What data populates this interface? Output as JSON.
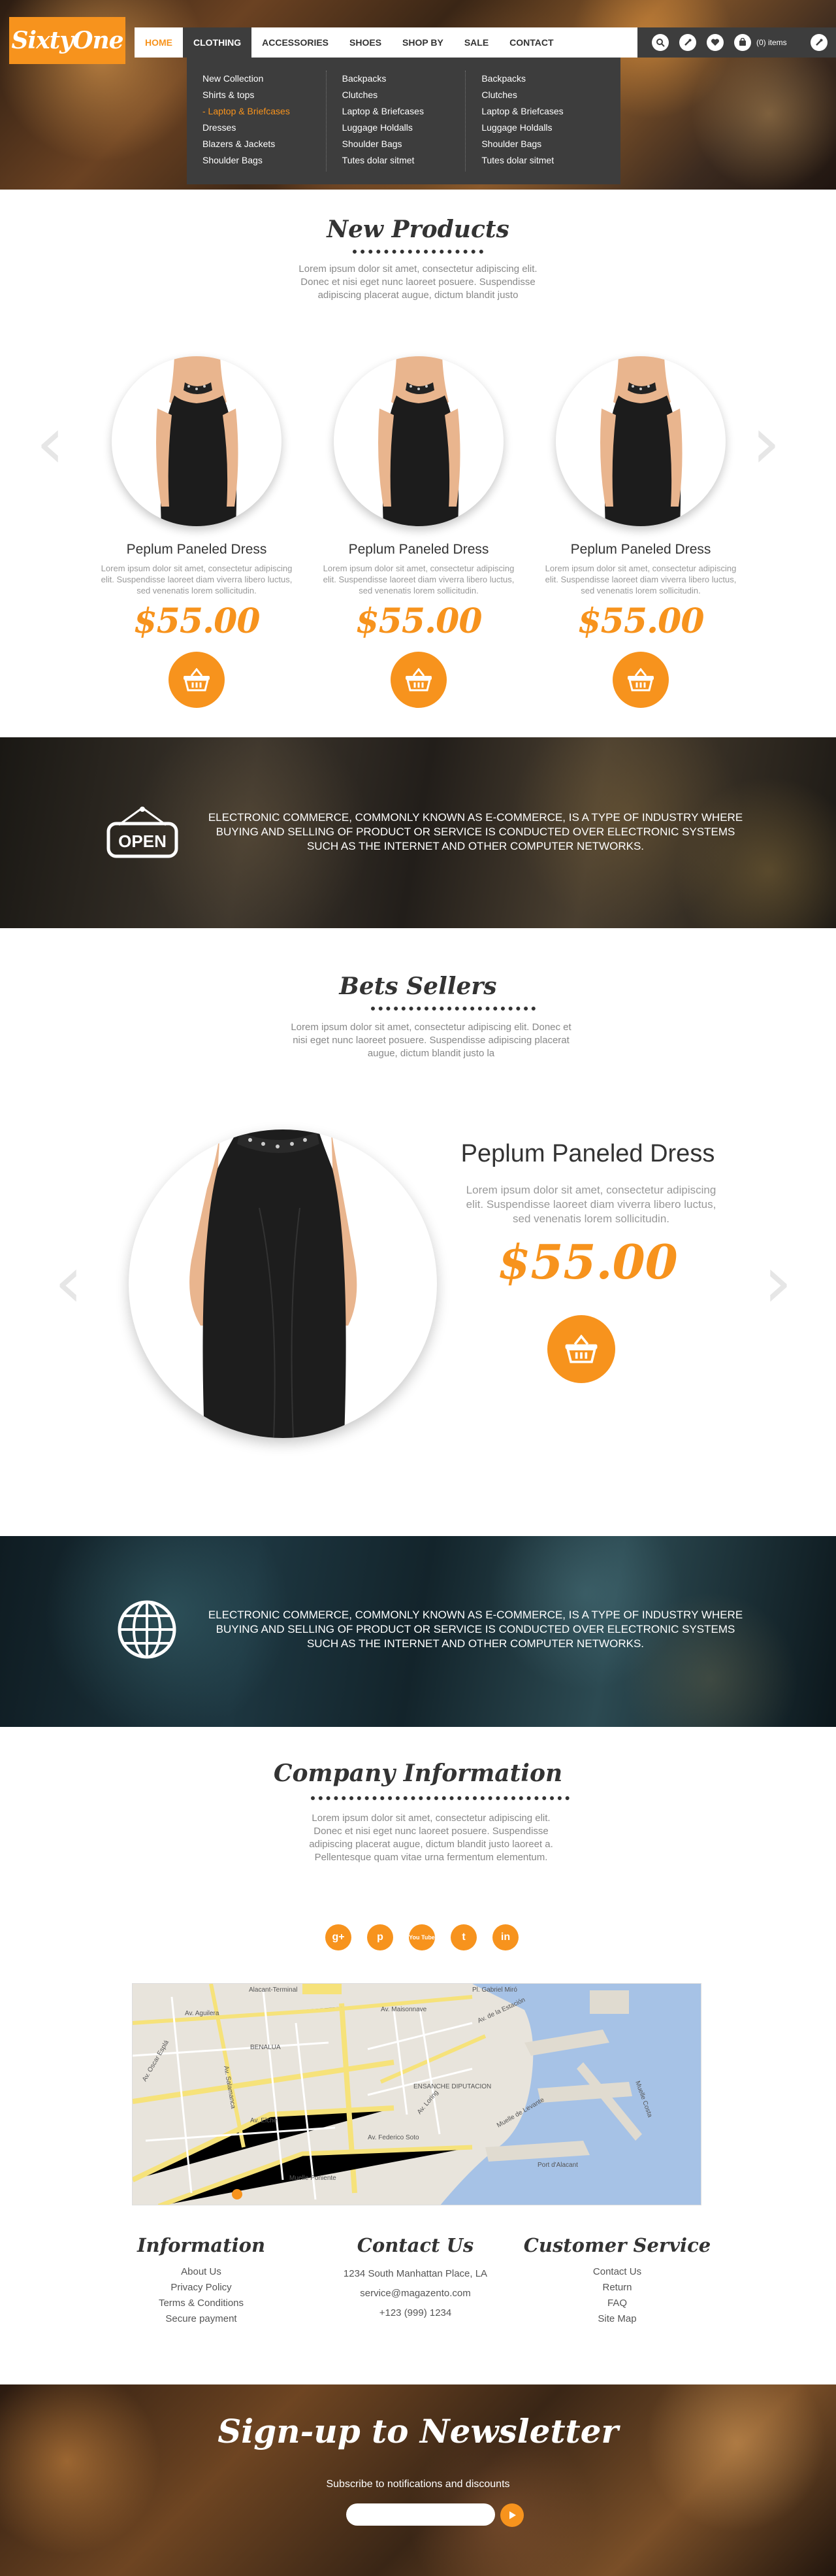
{
  "brand": {
    "logo_text": "SixtyOne"
  },
  "nav": {
    "items": [
      "HOME",
      "CLOTHING",
      "ACCESSORIES",
      "SHOES",
      "SHOP BY",
      "SALE",
      "CONTACT"
    ],
    "active": "HOME",
    "open": "CLOTHING",
    "cart_text": "(0) items"
  },
  "mega_menu": {
    "columns": [
      [
        "New Collection",
        "Shirts & tops",
        "- Laptop & Briefcases",
        "Dresses",
        "Blazers & Jackets",
        "Shoulder Bags"
      ],
      [
        "Backpacks",
        "Clutches",
        "Laptop & Briefcases",
        "Luggage Holdalls",
        "Shoulder Bags",
        "Tutes dolar sitmet"
      ],
      [
        "Backpacks",
        "Clutches",
        "Laptop & Briefcases",
        "Luggage Holdalls",
        "Shoulder Bags",
        "Tutes dolar sitmet"
      ]
    ]
  },
  "new_products": {
    "title": "New Products",
    "text": "Lorem ipsum dolor sit amet, consectetur adipiscing elit. Donec et nisi eget nunc laoreet posuere. Suspendisse adipiscing placerat augue, dictum blandit justo",
    "products": [
      {
        "name": "Peplum Paneled Dress",
        "desc": "Lorem ipsum dolor sit amet, consectetur adipiscing elit. Suspendisse laoreet diam viverra libero luctus, sed venenatis lorem sollicitudin.",
        "price": "$55.00"
      },
      {
        "name": "Peplum Paneled Dress",
        "desc": "Lorem ipsum dolor sit amet, consectetur adipiscing elit. Suspendisse laoreet diam viverra libero luctus, sed venenatis lorem sollicitudin.",
        "price": "$55.00"
      },
      {
        "name": "Peplum Paneled Dress",
        "desc": "Lorem ipsum dolor sit amet, consectetur adipiscing elit. Suspendisse laoreet diam viverra libero luctus, sed venenatis lorem sollicitudin.",
        "price": "$55.00"
      }
    ]
  },
  "banner1": {
    "sign_text": "OPEN",
    "text": "ELECTRONIC COMMERCE, COMMONLY KNOWN AS E-COMMERCE, IS A TYPE OF INDUSTRY WHERE BUYING AND SELLING OF PRODUCT OR SERVICE IS CONDUCTED OVER ELECTRONIC SYSTEMS SUCH AS THE INTERNET AND OTHER COMPUTER NETWORKS."
  },
  "best_sellers": {
    "title": "Bets Sellers",
    "text": "Lorem ipsum dolor sit amet, consectetur adipiscing elit. Donec et nisi eget nunc laoreet posuere. Suspendisse adipiscing placerat augue, dictum blandit justo la",
    "product": {
      "name": "Peplum Paneled Dress",
      "desc": "Lorem ipsum dolor sit amet, consectetur adipiscing elit. Suspendisse laoreet diam viverra libero luctus, sed venenatis lorem sollicitudin.",
      "price": "$55.00"
    }
  },
  "banner2": {
    "text": "ELECTRONIC COMMERCE, COMMONLY KNOWN AS E-COMMERCE, IS A TYPE OF INDUSTRY WHERE BUYING AND SELLING OF PRODUCT OR SERVICE IS CONDUCTED OVER ELECTRONIC SYSTEMS SUCH AS THE INTERNET AND OTHER COMPUTER NETWORKS."
  },
  "company": {
    "title": "Company Information",
    "text": "Lorem ipsum dolor sit amet, consectetur adipiscing elit. Donec et nisi eget nunc laoreet posuere. Suspendisse adipiscing placerat augue, dictum blandit justo laoreet a. Pellentesque quam vitae urna fermentum elementum."
  },
  "socials": [
    "g+",
    "p",
    "You Tube",
    "t",
    "in"
  ],
  "map": {
    "labels": [
      "Alacant-Terminal",
      "Av. Aguilera",
      "Av. Oscar Esplá",
      "BENALUA",
      "ENSANCHE DIPUTACION",
      "Av. Elche",
      "Muelle Poniente",
      "Av. Loring",
      "Pl. Gabriel Miró",
      "Av. de la Estación",
      "Av. Maisonnave",
      "Muelle de Levante",
      "Port d'Alacant",
      "Av. Salamanca",
      "Av. Federico Soto",
      "Muelle Costa"
    ]
  },
  "footer": {
    "information": {
      "title": "Information",
      "items": [
        "About Us",
        "Privacy Policy",
        "Terms & Conditions",
        "Secure payment"
      ]
    },
    "contact": {
      "title": "Contact Us",
      "items": [
        "1234 South Manhattan Place, LA",
        "service@magazento.com",
        "+123 (999) 1234"
      ]
    },
    "service": {
      "title": "Customer Service",
      "items": [
        "Contact Us",
        "Return",
        "FAQ",
        "Site Map"
      ]
    }
  },
  "newsletter": {
    "title": "Sign-up to Newsletter",
    "subtitle": "Subscribe to notifications and discounts",
    "input_value": "",
    "input_placeholder": ""
  },
  "colors": {
    "accent": "#f7931d",
    "nav_dark": "#3d3d3d"
  }
}
